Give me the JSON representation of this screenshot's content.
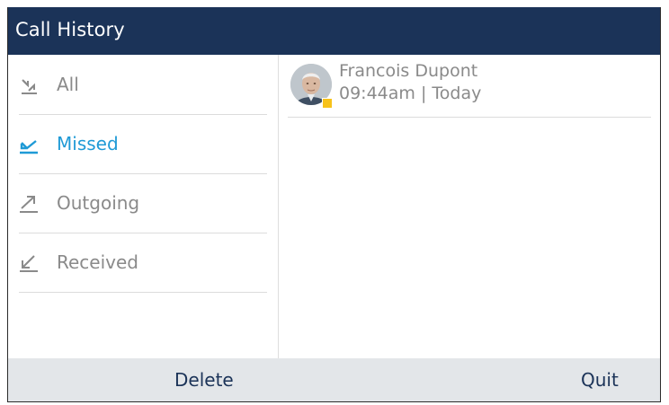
{
  "header": {
    "title": "Call History"
  },
  "sidebar": {
    "items": [
      {
        "label": "All",
        "icon": "all-calls-icon",
        "active": false
      },
      {
        "label": "Missed",
        "icon": "missed-call-icon",
        "active": true
      },
      {
        "label": "Outgoing",
        "icon": "outgoing-call-icon",
        "active": false
      },
      {
        "label": "Received",
        "icon": "received-call-icon",
        "active": false
      }
    ]
  },
  "calls": [
    {
      "name": "Francois Dupont",
      "time_label": "09:44am | Today",
      "presence_color": "#f7c21b"
    }
  ],
  "softkeys": {
    "delete_label": "Delete",
    "quit_label": "Quit"
  },
  "colors": {
    "header_bg": "#1b3358",
    "accent": "#1f9ad6",
    "muted_text": "#8a8a8a",
    "softkey_bar": "#e3e6e9"
  }
}
